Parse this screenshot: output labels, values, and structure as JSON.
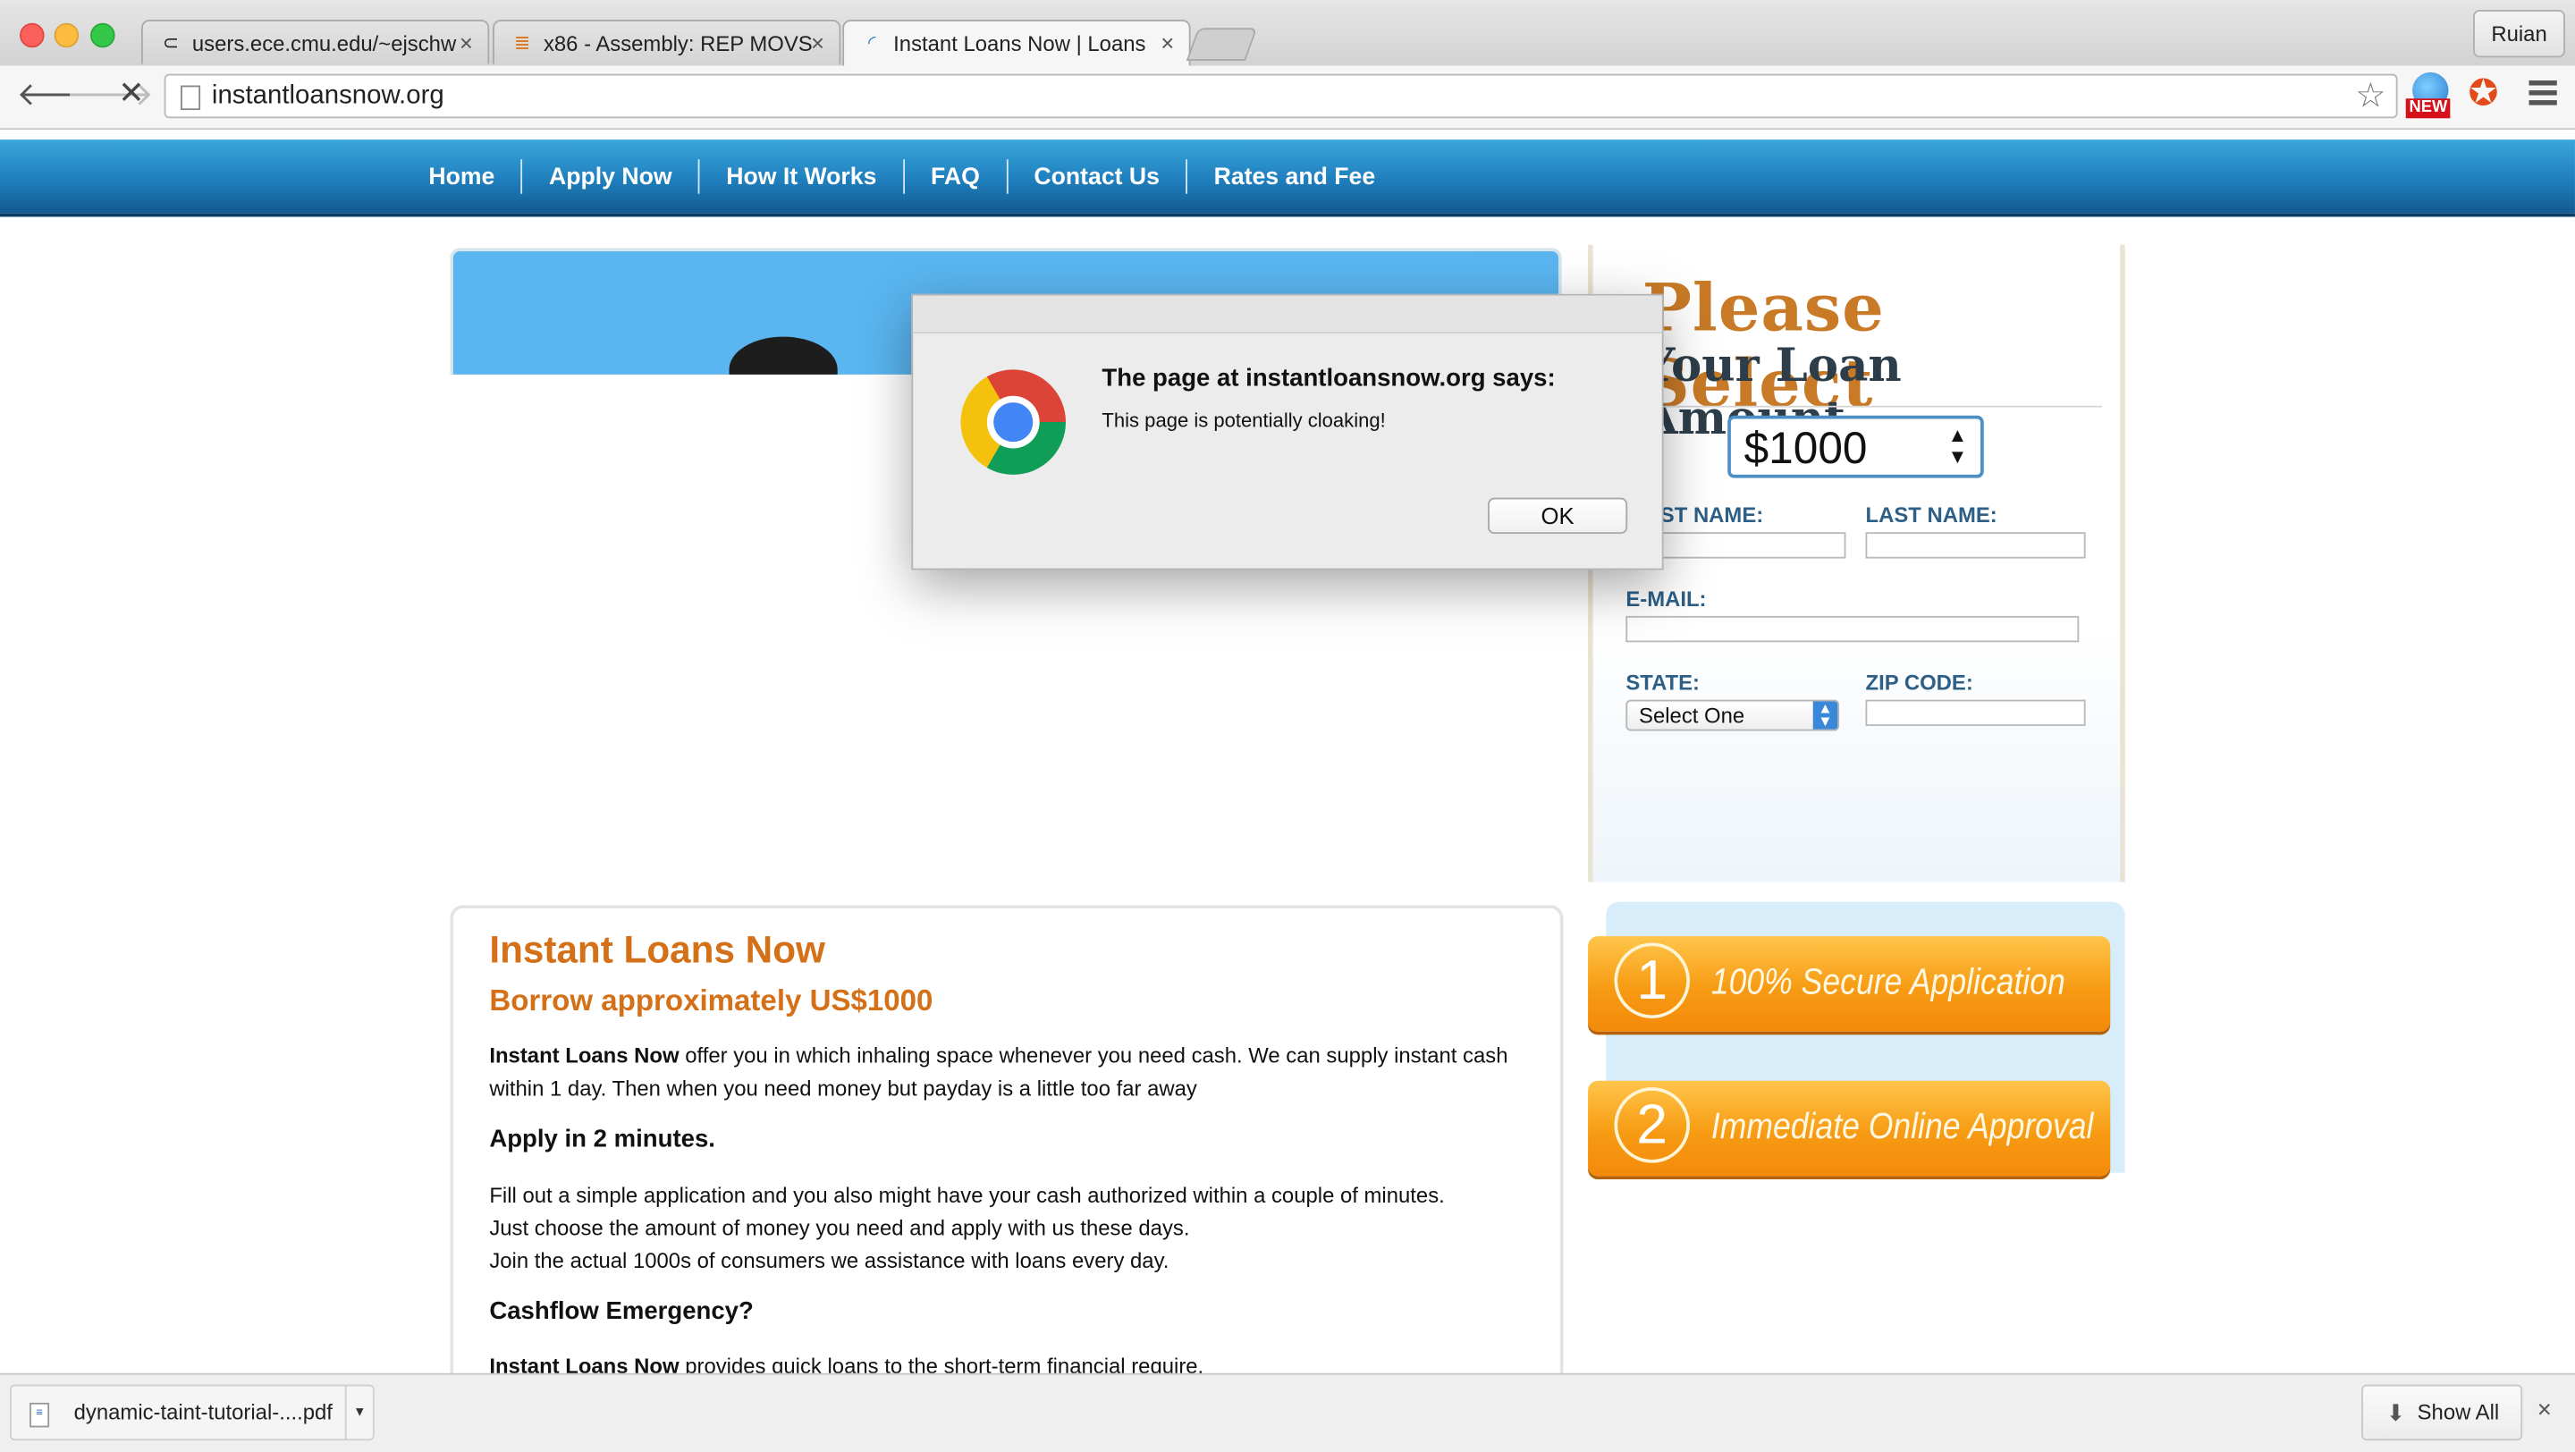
{
  "browser": {
    "tabs": [
      {
        "title": "users.ece.cmu.edu/~ejschw",
        "close": "×"
      },
      {
        "title": "x86 - Assembly: REP MOVS",
        "close": "×"
      },
      {
        "title": "Instant Loans Now | Loans",
        "close": "×"
      }
    ],
    "profile": "Ruian",
    "url": "instantloansnow.org",
    "ext_badge": "NEW"
  },
  "site": {
    "nav": [
      "Home",
      "Apply Now",
      "How It Works",
      "FAQ",
      "Contact Us",
      "Rates and Fee"
    ],
    "form": {
      "title_line1": "Please Select",
      "title_line2": "Your Loan Amount",
      "amount": "$1000",
      "first_name_label": "FIRST NAME:",
      "last_name_label": "LAST NAME:",
      "email_label": "E-MAIL:",
      "state_label": "STATE:",
      "zip_label": "ZIP CODE:",
      "state_value": "Select One"
    },
    "info": {
      "heading": "Instant Loans Now",
      "subheading": "Borrow approximately US$1000",
      "p1_bold": "Instant Loans Now",
      "p1_rest": " offer you in which inhaling space whenever you need cash. We can supply instant cash within 1 day. Then when you need money but payday is a little too far away",
      "h_apply": "Apply in 2 minutes.",
      "apply_line1": "Fill out a simple application and you also might have your cash authorized within a couple of minutes.",
      "apply_line2": "Just choose the amount of money you need and apply with us these days.",
      "apply_line3": "Join the actual 1000s of consumers we assistance with loans every day.",
      "h_cashflow": "Cashflow Emergency?",
      "p3_bold": "Instant Loans Now",
      "p3_rest": " provides quick loans to the short-term financial require."
    },
    "steps": [
      {
        "num": "1",
        "label": "100% Secure Application"
      },
      {
        "num": "2",
        "label": "Immediate Online Approval"
      }
    ]
  },
  "dialog": {
    "title": "The page at instantloansnow.org says:",
    "message": "This page is potentially cloaking!",
    "ok": "OK"
  },
  "downloads": {
    "file": "dynamic-taint-tutorial-....pdf",
    "show_all": "Show All",
    "close": "×"
  }
}
